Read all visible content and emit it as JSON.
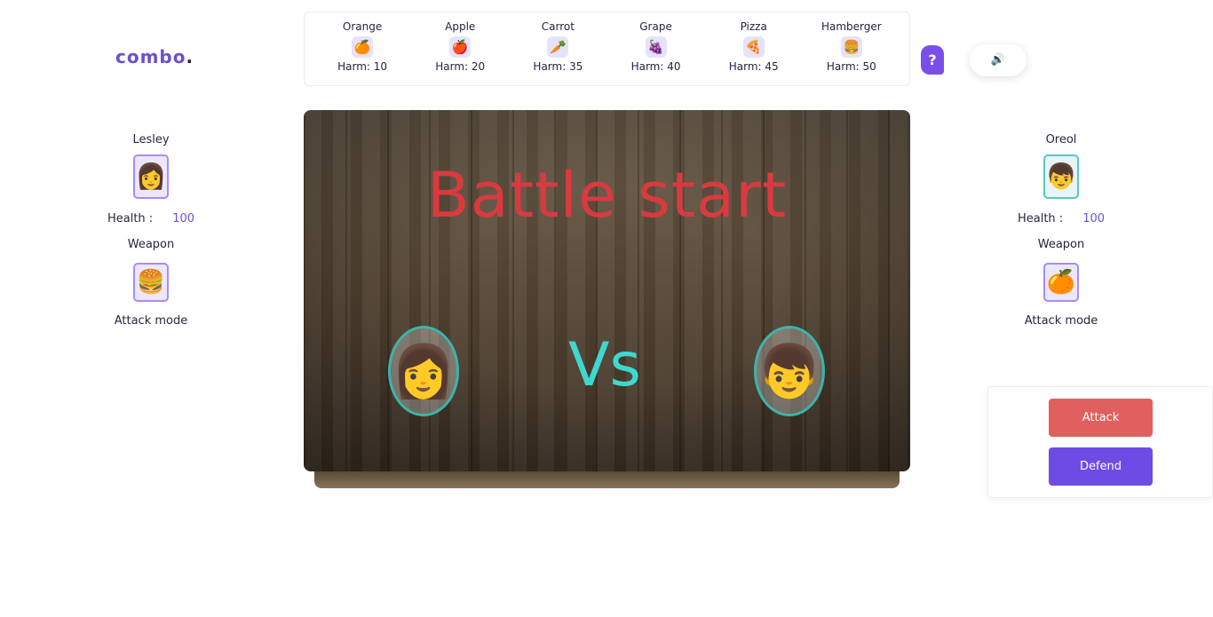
{
  "logo": {
    "text": "combo",
    "dot": "."
  },
  "foods": [
    {
      "name": "Orange",
      "icon": "🍊",
      "harm": "Harm: 10"
    },
    {
      "name": "Apple",
      "icon": "🍎",
      "harm": "Harm: 20"
    },
    {
      "name": "Carrot",
      "icon": "🥕",
      "harm": "Harm: 35"
    },
    {
      "name": "Grape",
      "icon": "🍇",
      "harm": "Harm: 40"
    },
    {
      "name": "Pizza",
      "icon": "🍕",
      "harm": "Harm: 45"
    },
    {
      "name": "Hamberger",
      "icon": "🍔",
      "harm": "Harm: 50"
    }
  ],
  "help": {
    "label": "?"
  },
  "sound": {
    "icon": "🔊"
  },
  "player1": {
    "name": "Lesley",
    "avatar": "👩",
    "health_label": "Health :",
    "health_value": "100",
    "weapon_label": "Weapon",
    "weapon_icon": "🍔",
    "mode": "Attack mode"
  },
  "player2": {
    "name": "Oreol",
    "avatar": "👦",
    "health_label": "Health :",
    "health_value": "100",
    "weapon_label": "Weapon",
    "weapon_icon": "🍊",
    "mode": "Attack mode"
  },
  "arena": {
    "title": "Battle start",
    "vs": "Vs",
    "left_fighter": "👩",
    "right_fighter": "👦"
  },
  "actions": {
    "attack": "Attack",
    "defend": "Defend"
  },
  "colors": {
    "accent": "#6f4be6",
    "attack": "#e0605f",
    "title": "#d93a40",
    "vs": "#3ed8cf"
  }
}
